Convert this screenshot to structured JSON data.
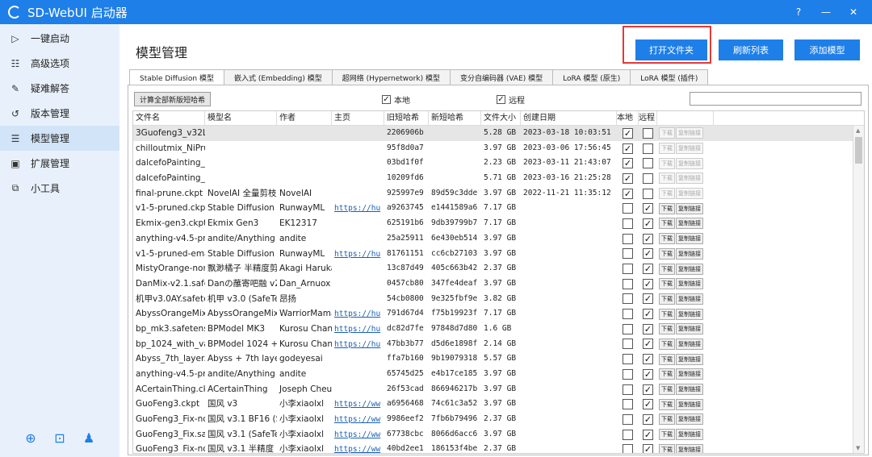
{
  "window": {
    "title": "SD-WebUI 启动器",
    "controls": [
      "?",
      "—",
      "✕"
    ]
  },
  "sidebar": {
    "items": [
      {
        "label": "一键启动",
        "icon": "▷",
        "icon_name": "play-icon"
      },
      {
        "label": "高级选项",
        "icon": "☷",
        "icon_name": "options-icon"
      },
      {
        "label": "疑难解答",
        "icon": "✎",
        "icon_name": "wrench-icon"
      },
      {
        "label": "版本管理",
        "icon": "↺",
        "icon_name": "history-icon"
      },
      {
        "label": "模型管理",
        "icon": "☰",
        "icon_name": "model-icon",
        "active": true
      },
      {
        "label": "扩展管理",
        "icon": "▣",
        "icon_name": "extension-icon"
      },
      {
        "label": "小工具",
        "icon": "⧉",
        "icon_name": "tools-icon"
      }
    ],
    "bottom_icons": [
      {
        "name": "globe-icon",
        "glyph": "⊕"
      },
      {
        "name": "bilibili-icon",
        "glyph": "⊡"
      },
      {
        "name": "qq-icon",
        "glyph": "♟"
      }
    ]
  },
  "page": {
    "title": "模型管理",
    "buttons": {
      "open_folder": "打开文件夹",
      "refresh": "刷新列表",
      "add_model": "添加模型"
    }
  },
  "tabs": [
    {
      "label": "Stable Diffusion 模型",
      "active": true
    },
    {
      "label": "嵌入式 (Embedding) 模型"
    },
    {
      "label": "超网络 (Hypernetwork) 模型"
    },
    {
      "label": "变分自编码器 (VAE) 模型"
    },
    {
      "label": "LoRA 模型 (原生)"
    },
    {
      "label": "LoRA 模型 (插件)"
    }
  ],
  "toolbar": {
    "calc_label": "计算全部新版短哈希",
    "filter_local": "本地",
    "filter_remote": "远程",
    "filter_local_checked": true,
    "filter_remote_checked": true,
    "search_value": ""
  },
  "table": {
    "headers": [
      "文件名",
      "模型名",
      "作者",
      "主页",
      "旧短哈希",
      "新短哈希",
      "文件大小",
      "创建日期",
      "本地",
      "远程"
    ],
    "action_download": "下载",
    "action_copy": "复制链接",
    "rows": [
      {
        "file": "3Guofeng3_v32Lig",
        "model": "",
        "author": "",
        "home": "",
        "old": "2206906b",
        "new": "",
        "size": "5.28 GB",
        "date": "2023-03-18 10:03:51",
        "local": true,
        "remote": false,
        "sel": true
      },
      {
        "file": "chilloutmix_NiPrun",
        "model": "",
        "author": "",
        "home": "",
        "old": "95f8d0a7",
        "new": "",
        "size": "3.97 GB",
        "date": "2023-03-06 17:56:45",
        "local": true,
        "remote": false
      },
      {
        "file": "dalcefoPainting_3",
        "model": "",
        "author": "",
        "home": "",
        "old": "03bd1f0f",
        "new": "",
        "size": "2.23 GB",
        "date": "2023-03-11 21:43:07",
        "local": true,
        "remote": false
      },
      {
        "file": "dalcefoPainting_v",
        "model": "",
        "author": "",
        "home": "",
        "old": "10209fd6",
        "new": "",
        "size": "5.71 GB",
        "date": "2023-03-16 21:25:28",
        "local": true,
        "remote": false
      },
      {
        "file": "final-prune.ckpt",
        "model": "NovelAI 全量剪枝",
        "author": "NovelAI",
        "home": "",
        "old": "925997e9",
        "new": "89d59c3dde",
        "size": "3.97 GB",
        "date": "2022-11-21 11:35:12",
        "local": true,
        "remote": false
      },
      {
        "file": "v1-5-pruned.ckpt",
        "model": "Stable Diffusion v",
        "author": "RunwayML",
        "home": "https://hu",
        "old": "a9263745",
        "new": "e1441589a6",
        "size": "7.17 GB",
        "date": "",
        "local": false,
        "remote": true
      },
      {
        "file": "Ekmix-gen3.ckpt",
        "model": "Ekmix Gen3",
        "author": "EK12317",
        "home": "",
        "old": "625191b6",
        "new": "9db39799b7",
        "size": "7.17 GB",
        "date": "",
        "local": false,
        "remote": true
      },
      {
        "file": "anything-v4.5-pru",
        "model": "andite/Anything v",
        "author": "andite",
        "home": "",
        "old": "25a25911",
        "new": "6e430eb514",
        "size": "3.97 GB",
        "date": "",
        "local": false,
        "remote": true
      },
      {
        "file": "v1-5-pruned-ema",
        "model": "Stable Diffusion v",
        "author": "RunwayML",
        "home": "https://hu",
        "old": "81761151",
        "new": "cc6cb27103",
        "size": "3.97 GB",
        "date": "",
        "local": false,
        "remote": true
      },
      {
        "file": "MistyOrange-non",
        "model": "飘渺橘子 半精度剪枝",
        "author": "Akagi Haruka",
        "home": "",
        "old": "13c87d49",
        "new": "405c663b42",
        "size": "2.37 GB",
        "date": "",
        "local": false,
        "remote": true
      },
      {
        "file": "DanMix-v2.1.safet",
        "model": "Danの蘸寄吧融 v2.",
        "author": "Dan_Arnuox",
        "home": "",
        "old": "0457cb80",
        "new": "347fe4deaf",
        "size": "3.97 GB",
        "date": "",
        "local": false,
        "remote": true
      },
      {
        "file": "机甲v3.0AY.safeter",
        "model": "机甲 v3.0 (SafeTen",
        "author": "昂扬",
        "home": "",
        "old": "54cb0800",
        "new": "9e325fbf9e",
        "size": "3.82 GB",
        "date": "",
        "local": false,
        "remote": true
      },
      {
        "file": "AbyssOrangeMix2",
        "model": "AbyssOrangeMix2",
        "author": "WarriorMama",
        "home": "https://hu",
        "old": "791d67d4",
        "new": "f75b19923f",
        "size": "7.17 GB",
        "date": "",
        "local": false,
        "remote": true
      },
      {
        "file": "bp_mk3.safetenso",
        "model": "BPModel MK3",
        "author": "Kurosu Chan",
        "home": "https://hu",
        "old": "dc82d7fe",
        "new": "97848d7d80",
        "size": "1.6 GB",
        "date": "",
        "local": false,
        "remote": true
      },
      {
        "file": "bp_1024_with_vae",
        "model": "BPModel 1024 + V",
        "author": "Kurosu Chan",
        "home": "https://hu",
        "old": "47bb3b77",
        "new": "d5d6e1898f",
        "size": "2.14 GB",
        "date": "",
        "local": false,
        "remote": true
      },
      {
        "file": "Abyss_7th_layer.cl",
        "model": "Abyss + 7th layer",
        "author": "godeyesai",
        "home": "",
        "old": "ffa7b160",
        "new": "9b19079318",
        "size": "5.57 GB",
        "date": "",
        "local": false,
        "remote": true
      },
      {
        "file": "anything-v4.5-pru",
        "model": "andite/Anything v",
        "author": "andite",
        "home": "",
        "old": "65745d25",
        "new": "e4b17ce185",
        "size": "3.97 GB",
        "date": "",
        "local": false,
        "remote": true
      },
      {
        "file": "ACertainThing.ckp",
        "model": "ACertainThing",
        "author": "Joseph Cheun",
        "home": "",
        "old": "26f53cad",
        "new": "866946217b",
        "size": "3.97 GB",
        "date": "",
        "local": false,
        "remote": true
      },
      {
        "file": "GuoFeng3.ckpt",
        "model": "国风 v3",
        "author": "小李xiaolxl",
        "home": "https://ww",
        "old": "a6956468",
        "new": "74c61c3a52",
        "size": "3.97 GB",
        "date": "",
        "local": false,
        "remote": true
      },
      {
        "file": "GuoFeng3_Fix-nor",
        "model": "国风 v3.1 BF16 (Sa",
        "author": "小李xiaolxl",
        "home": "https://ww",
        "old": "9986eef2",
        "new": "7fb6b79496",
        "size": "2.37 GB",
        "date": "",
        "local": false,
        "remote": true
      },
      {
        "file": "GuoFeng3_Fix.safe",
        "model": "国风 v3.1 (SafeTen",
        "author": "小李xiaolxl",
        "home": "https://ww",
        "old": "67738cbc",
        "new": "8066d6acc6",
        "size": "3.97 GB",
        "date": "",
        "local": false,
        "remote": true
      },
      {
        "file": "GuoFeng3_Fix-nor",
        "model": "国风 v3.1 半精度 (S",
        "author": "小李xiaolxl",
        "home": "https://ww",
        "old": "40bd2ee1",
        "new": "186153f4be",
        "size": "2.37 GB",
        "date": "",
        "local": false,
        "remote": true
      }
    ]
  },
  "colors": {
    "accent": "#1e7fe8",
    "sidebar_bg": "#e8f1fb",
    "highlight": "#e53935"
  }
}
